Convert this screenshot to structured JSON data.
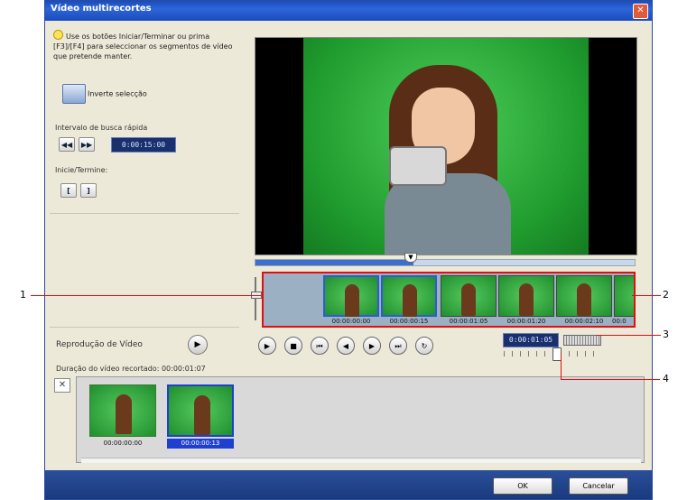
{
  "window": {
    "title": "Vídeo multirecortes"
  },
  "left": {
    "hint": "Use os botões Iniciar/Terminar ou prima [F3]/[F4] para seleccionar os segmentos de vídeo que pretende manter.",
    "invert_label": "Inverte selecção",
    "fast_search_label": "Intervalo de busca rápida",
    "fast_search_value": "0:00:15:00",
    "start_end_label": "Inicie/Termine:",
    "start_btn": "[",
    "end_btn": "]"
  },
  "strip": {
    "timecodes": [
      "00:00:00:00",
      "00:00:00:15",
      "00:00:01:05",
      "00:00:01:20",
      "00:00:02:10",
      "00:0"
    ]
  },
  "transport": {
    "timecode": "0:00:01:05"
  },
  "playback": {
    "label": "Reprodução de Vídeo",
    "duration": "Duração do vídeo recortado: 00:00:01:07"
  },
  "clips": {
    "items": [
      {
        "timecode": "00:00:00:00"
      },
      {
        "timecode": "00:00:00:13"
      }
    ]
  },
  "buttons": {
    "ok": "OK",
    "cancel": "Cancelar"
  },
  "callouts": [
    "1",
    "2",
    "3",
    "4"
  ],
  "colors": {
    "accent": "#2d66d8",
    "highlight": "#e01010",
    "screen": "#1f9a2d"
  }
}
